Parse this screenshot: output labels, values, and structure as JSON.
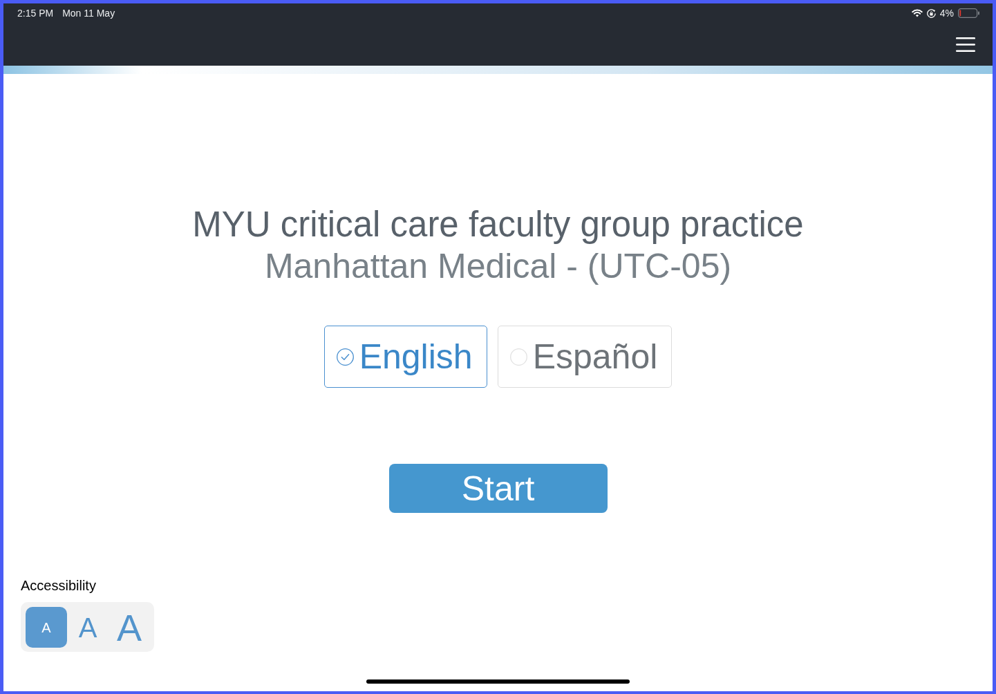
{
  "status_bar": {
    "time": "2:15 PM",
    "date": "Mon 11 May",
    "battery_text": "4%"
  },
  "title": "MYU critical care faculty group practice",
  "subtitle": "Manhattan Medical - (UTC-05)",
  "languages": [
    {
      "label": "English",
      "selected": true
    },
    {
      "label": "Español",
      "selected": false
    }
  ],
  "start_button": {
    "label": "Start"
  },
  "accessibility": {
    "label": "Accessibility",
    "text_sizes": [
      {
        "label": "A",
        "kind": "small",
        "selected": true
      },
      {
        "label": "A",
        "kind": "medium",
        "selected": false
      },
      {
        "label": "A",
        "kind": "large",
        "selected": false
      }
    ]
  }
}
